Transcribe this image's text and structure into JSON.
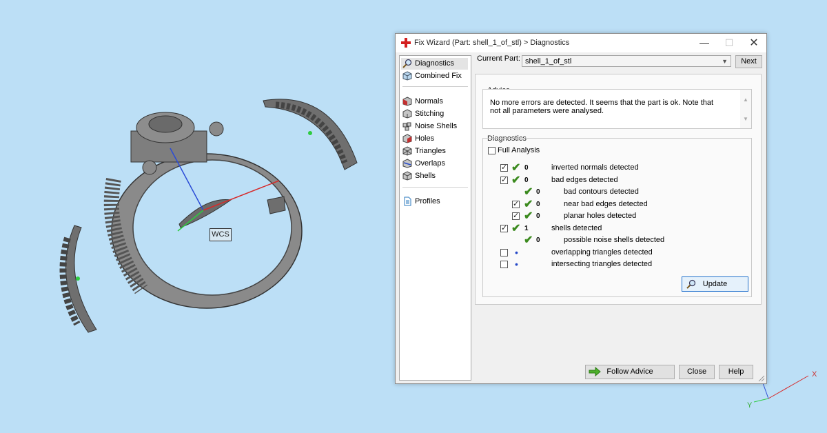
{
  "viewport": {
    "wcs_label": "WCS",
    "axis_x_label": "X",
    "axis_y_label": "Y"
  },
  "window": {
    "title": "Fix Wizard (Part: shell_1_of_stl) > Diagnostics",
    "min_glyph": "—",
    "max_glyph": "☐",
    "close_glyph": "✕"
  },
  "nav": {
    "items": [
      {
        "label": "Diagnostics",
        "icon": "magnifier-icon"
      },
      {
        "label": "Combined Fix",
        "icon": "cube-icon"
      },
      {
        "label": "Normals",
        "icon": "normals-cube-icon"
      },
      {
        "label": "Stitching",
        "icon": "stitching-cube-icon"
      },
      {
        "label": "Noise Shells",
        "icon": "noise-shells-icon"
      },
      {
        "label": "Holes",
        "icon": "holes-cube-icon"
      },
      {
        "label": "Triangles",
        "icon": "triangles-cube-icon"
      },
      {
        "label": "Overlaps",
        "icon": "overlaps-cube-icon"
      },
      {
        "label": "Shells",
        "icon": "shells-cube-icon"
      },
      {
        "label": "Profiles",
        "icon": "document-icon"
      }
    ]
  },
  "current_part": {
    "label": "Current Part:",
    "value": "shell_1_of_stl",
    "next_label": "Next"
  },
  "advice": {
    "title": "Advice",
    "text": "No more errors are detected. It seems that the part is ok. Note that not all parameters were analysed."
  },
  "diagnostics": {
    "title": "Diagnostics",
    "full_analysis_label": "Full Analysis",
    "full_analysis_checked": false,
    "rows": [
      {
        "checkbox": true,
        "checked": true,
        "status": "ok",
        "count": "0",
        "label": "inverted normals detected",
        "indent": 0
      },
      {
        "checkbox": true,
        "checked": true,
        "status": "ok",
        "count": "0",
        "label": "bad edges detected",
        "indent": 0
      },
      {
        "checkbox": false,
        "checked": false,
        "status": "ok",
        "count": "0",
        "label": "bad contours detected",
        "indent": 1
      },
      {
        "checkbox": true,
        "checked": true,
        "status": "ok",
        "count": "0",
        "label": "near bad edges detected",
        "indent": 1
      },
      {
        "checkbox": true,
        "checked": true,
        "status": "ok",
        "count": "0",
        "label": "planar holes detected",
        "indent": 1
      },
      {
        "checkbox": true,
        "checked": true,
        "status": "ok",
        "count": "1",
        "label": "shells detected",
        "indent": 0
      },
      {
        "checkbox": false,
        "checked": false,
        "status": "ok",
        "count": "0",
        "label": "possible noise shells detected",
        "indent": 1
      },
      {
        "checkbox": true,
        "checked": false,
        "status": "none",
        "count": "",
        "label": "overlapping triangles detected",
        "indent": 0
      },
      {
        "checkbox": true,
        "checked": false,
        "status": "none",
        "count": "",
        "label": "intersecting triangles detected",
        "indent": 0
      }
    ],
    "update_label": "Update"
  },
  "footer": {
    "follow_advice_label": "Follow Advice",
    "close_label": "Close",
    "help_label": "Help"
  },
  "colors": {
    "background": "#bcdff6",
    "model_gray": "#7a7a7a",
    "check_green": "#3b8a1e",
    "dot_blue": "#2448c8",
    "focus_blue": "#1e6fcc"
  }
}
